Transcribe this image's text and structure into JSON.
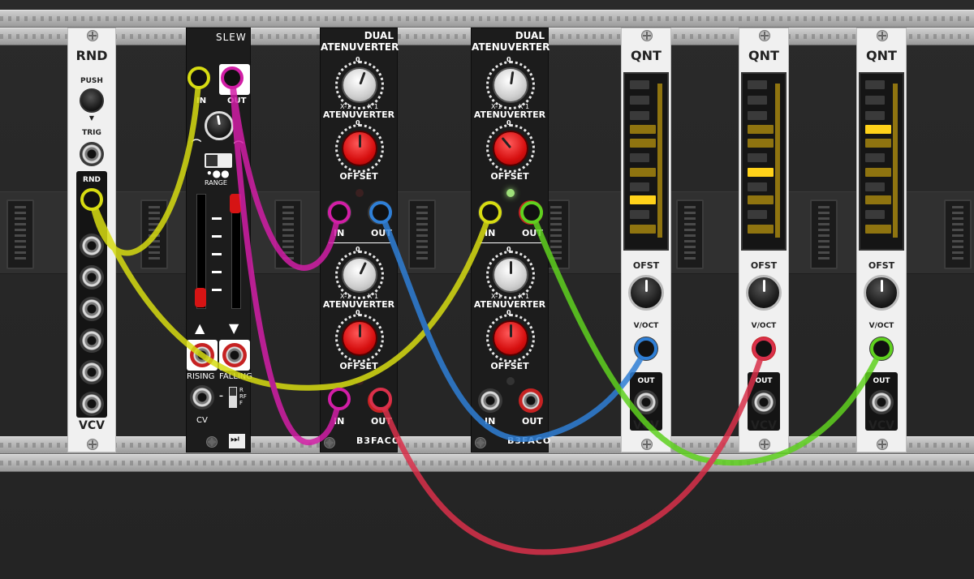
{
  "modules": {
    "rnd": {
      "title": "RND",
      "push_label": "PUSH",
      "trig_label": "TRIG",
      "rnd_label": "RND",
      "brand": "VCV"
    },
    "slew": {
      "title": "SLEW",
      "in_label": "IN",
      "out_label": "OUT",
      "range_label": "RANGE",
      "rising_label": "RISING",
      "falling_label": "FALLING",
      "cv_label": "CV",
      "mode_labels": "R\nRF\nF"
    },
    "dual1": {
      "title_line1": "DUAL",
      "title_line2": "ATENUVERTER",
      "atn_label": "ATENUVERTER",
      "offset_label": "OFFSET",
      "zero_label": "0",
      "xm1_label": "X-1",
      "x1_label": "X 1",
      "in_label": "IN",
      "out_label": "OUT",
      "brand": "B3FACO"
    },
    "dual2": {
      "title_line1": "DUAL",
      "title_line2": "ATENUVERTER",
      "atn_label": "ATENUVERTER",
      "offset_label": "OFFSET",
      "zero_label": "0",
      "xm1_label": "X-1",
      "x1_label": "X 1",
      "in_label": "IN",
      "out_label": "OUT",
      "brand": "B3FACO"
    },
    "qnt1": {
      "title": "QNT",
      "ofst_label": "OFST",
      "voct_label": "V/OCT",
      "out_label": "OUT",
      "brand": "VCV"
    },
    "qnt2": {
      "title": "QNT",
      "ofst_label": "OFST",
      "voct_label": "V/OCT",
      "out_label": "OUT",
      "brand": "VCV"
    },
    "qnt3": {
      "title": "QNT",
      "ofst_label": "OFST",
      "voct_label": "V/OCT",
      "out_label": "OUT",
      "brand": "VCV"
    }
  },
  "colors": {
    "cable_yellow": "#d7dc12",
    "cable_magenta": "#d21ea6",
    "cable_blue": "#2f7fd6",
    "cable_green": "#5fd11f",
    "cable_red": "#d9304a",
    "quantizer_key": "#8f7410",
    "quantizer_key_active": "#ffd21a",
    "knob_red": "#d60f0f"
  }
}
